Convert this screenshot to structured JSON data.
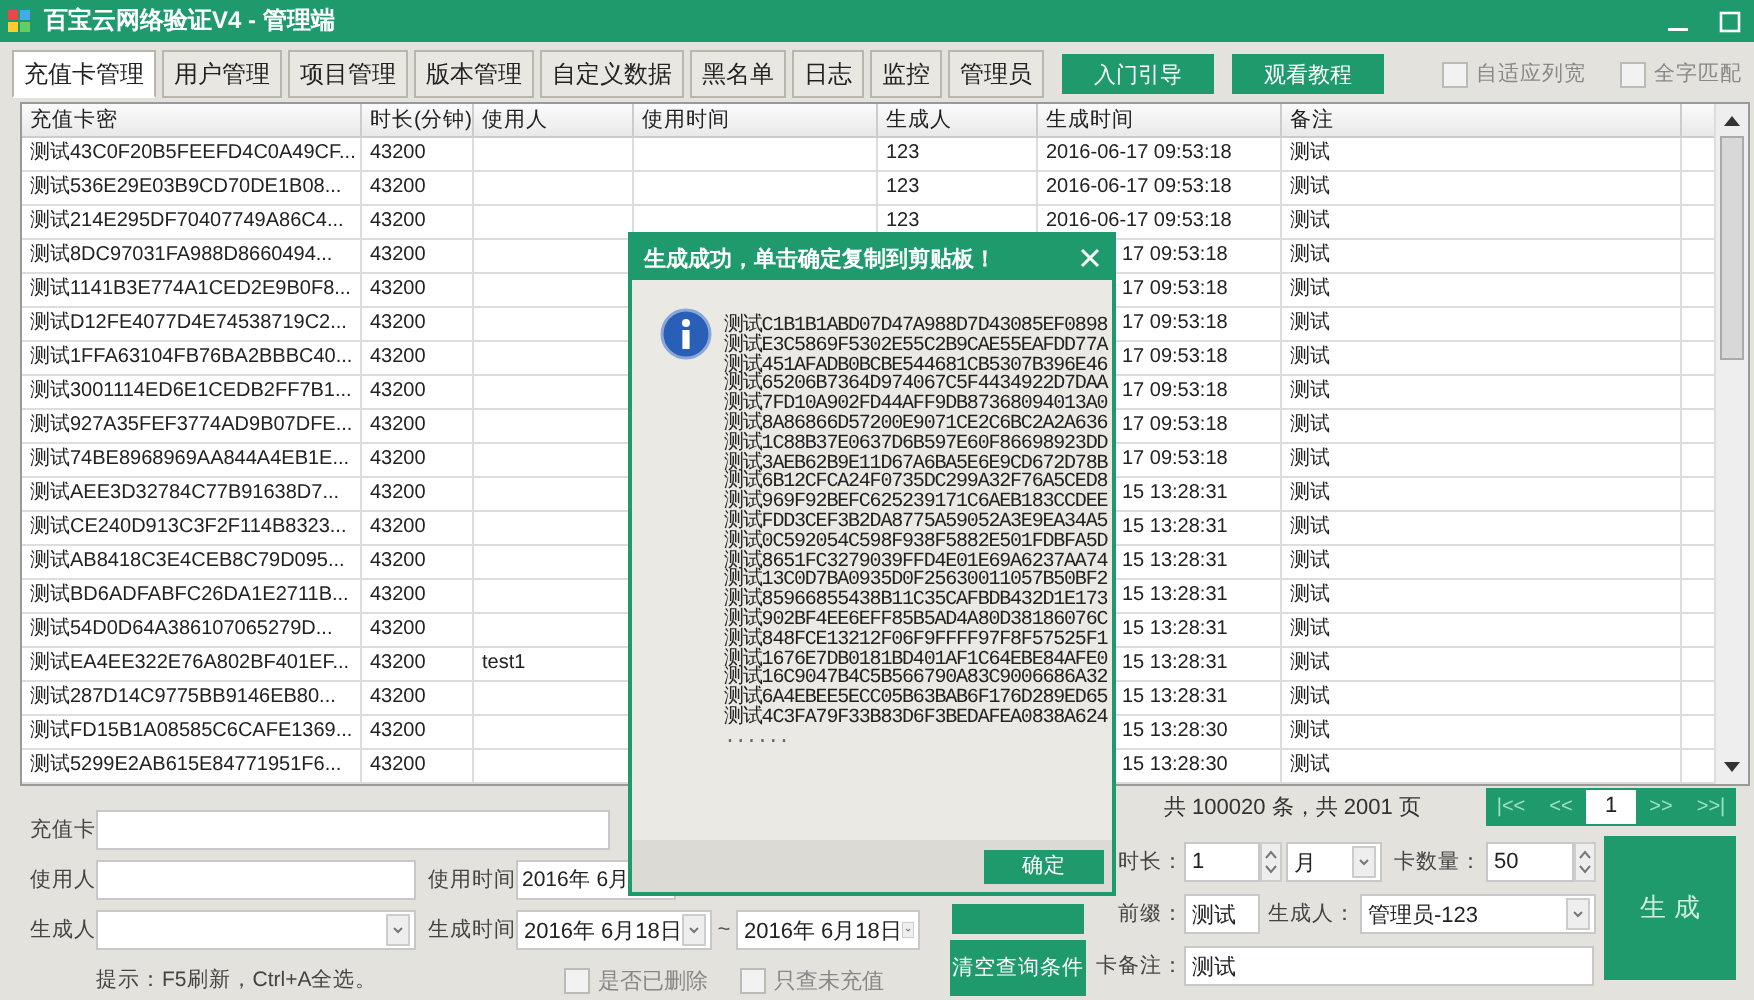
{
  "window": {
    "title": "百宝云网络验证V4 - 管理端"
  },
  "tabs": [
    {
      "label": "充值卡管理",
      "selected": true
    },
    {
      "label": "用户管理",
      "selected": false
    },
    {
      "label": "项目管理",
      "selected": false
    },
    {
      "label": "版本管理",
      "selected": false
    },
    {
      "label": "自定义数据",
      "selected": false
    },
    {
      "label": "黑名单",
      "selected": false
    },
    {
      "label": "日志",
      "selected": false
    },
    {
      "label": "监控",
      "selected": false
    },
    {
      "label": "管理员",
      "selected": false
    }
  ],
  "top_buttons": [
    "入门引导",
    "观看教程"
  ],
  "options": [
    {
      "label": "自适应列宽",
      "checked": false
    },
    {
      "label": "全字匹配",
      "checked": false
    }
  ],
  "table": {
    "columns": [
      "充值卡密",
      "时长(分钟)",
      "使用人",
      "使用时间",
      "生成人",
      "生成时间",
      "备注"
    ],
    "rows": [
      {
        "card": "测试43C0F20B5FEEFD4C0A49CF...",
        "duration": "43200",
        "generator": "123",
        "created": "2016-06-17 09:53:18",
        "note": "测试",
        "covered": false
      },
      {
        "card": "测试536E29E03B9CD70DE1B08...",
        "duration": "43200",
        "generator": "123",
        "created": "2016-06-17 09:53:18",
        "note": "测试",
        "covered": false
      },
      {
        "card": "测试214E295DF70407749A86C4...",
        "duration": "43200",
        "generator": "123",
        "created": "2016-06-17 09:53:18",
        "note": "测试",
        "covered": false
      },
      {
        "card": "测试8DC97031FA988D8660494...",
        "duration": "43200",
        "created": "17 09:53:18",
        "note": "测试",
        "covered": true
      },
      {
        "card": "测试1141B3E774A1CED2E9B0F8...",
        "duration": "43200",
        "created": "17 09:53:18",
        "note": "测试",
        "covered": true
      },
      {
        "card": "测试D12FE4077D4E74538719C2...",
        "duration": "43200",
        "created": "17 09:53:18",
        "note": "测试",
        "covered": true
      },
      {
        "card": "测试1FFA63104FB76BA2BBBC40...",
        "duration": "43200",
        "created": "17 09:53:18",
        "note": "测试",
        "covered": true
      },
      {
        "card": "测试3001114ED6E1CEDB2FF7B1...",
        "duration": "43200",
        "created": "17 09:53:18",
        "note": "测试",
        "covered": true
      },
      {
        "card": "测试927A35FEF3774AD9B07DFE...",
        "duration": "43200",
        "created": "17 09:53:18",
        "note": "测试",
        "covered": true
      },
      {
        "card": "测试74BE8968969AA844A4EB1E...",
        "duration": "43200",
        "created": "17 09:53:18",
        "note": "测试",
        "covered": true
      },
      {
        "card": "测试AEE3D32784C77B91638D7...",
        "duration": "43200",
        "created": "15 13:28:31",
        "note": "测试",
        "covered": true
      },
      {
        "card": "测试CE240D913C3F2F114B8323...",
        "duration": "43200",
        "created": "15 13:28:31",
        "note": "测试",
        "covered": true
      },
      {
        "card": "测试AB8418C3E4CEB8C79D095...",
        "duration": "43200",
        "created": "15 13:28:31",
        "note": "测试",
        "covered": true
      },
      {
        "card": "测试BD6ADFABFC26DA1E2711B...",
        "duration": "43200",
        "created": "15 13:28:31",
        "note": "测试",
        "covered": true
      },
      {
        "card": "测试54D0D64A386107065279D...",
        "duration": "43200",
        "created": "15 13:28:31",
        "note": "测试",
        "covered": true
      },
      {
        "card": "测试EA4EE322E76A802BF401EF...",
        "duration": "43200",
        "user": "test1",
        "created": "15 13:28:31",
        "note": "测试",
        "covered": true
      },
      {
        "card": "测试287D14C9775BB9146EB80...",
        "duration": "43200",
        "created": "15 13:28:31",
        "note": "测试",
        "covered": true
      },
      {
        "card": "测试FD15B1A08585C6CAFE1369...",
        "duration": "43200",
        "created": "15 13:28:30",
        "note": "测试",
        "covered": true
      },
      {
        "card": "测试5299E2AB615E84771951F6...",
        "duration": "43200",
        "created": "15 13:28:30",
        "note": "测试",
        "covered": true
      }
    ]
  },
  "filters": {
    "card": {
      "label": "充值卡"
    },
    "user": {
      "label": "使用人"
    },
    "use_time": {
      "label": "使用时间",
      "value": "2016年 6月"
    },
    "generator": {
      "label": "生成人"
    },
    "gen_time": {
      "label": "生成时间",
      "from": "2016年 6月18日",
      "separator": "~",
      "to": "2016年 6月18日"
    },
    "hint": "提示：F5刷新，Ctrl+A全选。",
    "checkboxes": [
      {
        "label": "是否已删除",
        "checked": false
      },
      {
        "label": "只查未充值",
        "checked": false
      }
    ]
  },
  "clear_button": "清空查询条件",
  "pagination": {
    "summary": "共 100020 条，共 2001 页",
    "first": "|<<",
    "prev": "<<",
    "page": "1",
    "next": ">>",
    "last": ">>|"
  },
  "generate": {
    "duration": {
      "label": "时长：",
      "value": "1",
      "unit": "月"
    },
    "count": {
      "label": "卡数量：",
      "value": "50"
    },
    "prefix": {
      "label": "前缀：",
      "value": "测试"
    },
    "generator": {
      "label": "生成人：",
      "value": "管理员-123"
    },
    "note": {
      "label": "卡备注：",
      "value": "测试"
    },
    "button": "生 成"
  },
  "dialog": {
    "title": "生成成功，单击确定复制到剪贴板！",
    "lines": [
      "测试C1B1B1ABD07D47A988D7D43085EF0898",
      "测试E3C5869F5302E55C2B9CAE55EAFDD77A",
      "测试451AFADB0BCBE544681CB5307B396E46",
      "测试65206B7364D974067C5F4434922D7DAA",
      "测试7FD10A902FD44AFF9DB87368094013A0",
      "测试8A86866D57200E9071CE2C6BC2A2A636",
      "测试1C88B37E0637D6B597E60F86698923DD",
      "测试3AEB62B9E11D67A6BA5E6E9CD672D78B",
      "测试6B12CFCA24F0735DC299A32F76A5CED8",
      "测试969F92BEFC625239171C6AEB183CCDEE",
      "测试FDD3CEF3B2DA8775A59052A3E9EA34A5",
      "测试0C592054C598F938F5882E501FDBFA5D",
      "测试8651FC3279039FFD4E01E69A6237AA74",
      "测试13C0D7BA0935D0F25630011057B50BF2",
      "测试85966855438B11C35CAFBDB432D1E173",
      "测试902BF4EE6EFF85B5AD4A80D38186076C",
      "测试848FCE13212F06F9FFFF97F8F57525F1",
      "测试1676E7DB0181BD401AF1C64EBE84AFE0",
      "测试16C9047B4C5B566790A83C9006686A32",
      "测试6A4EBEE5ECC05B63BAB6F176D289ED65",
      "测试4C3FA79F33B83D6F3BEDAFEA0838A624"
    ],
    "ellipsis": "......",
    "ok_button": "确定"
  }
}
